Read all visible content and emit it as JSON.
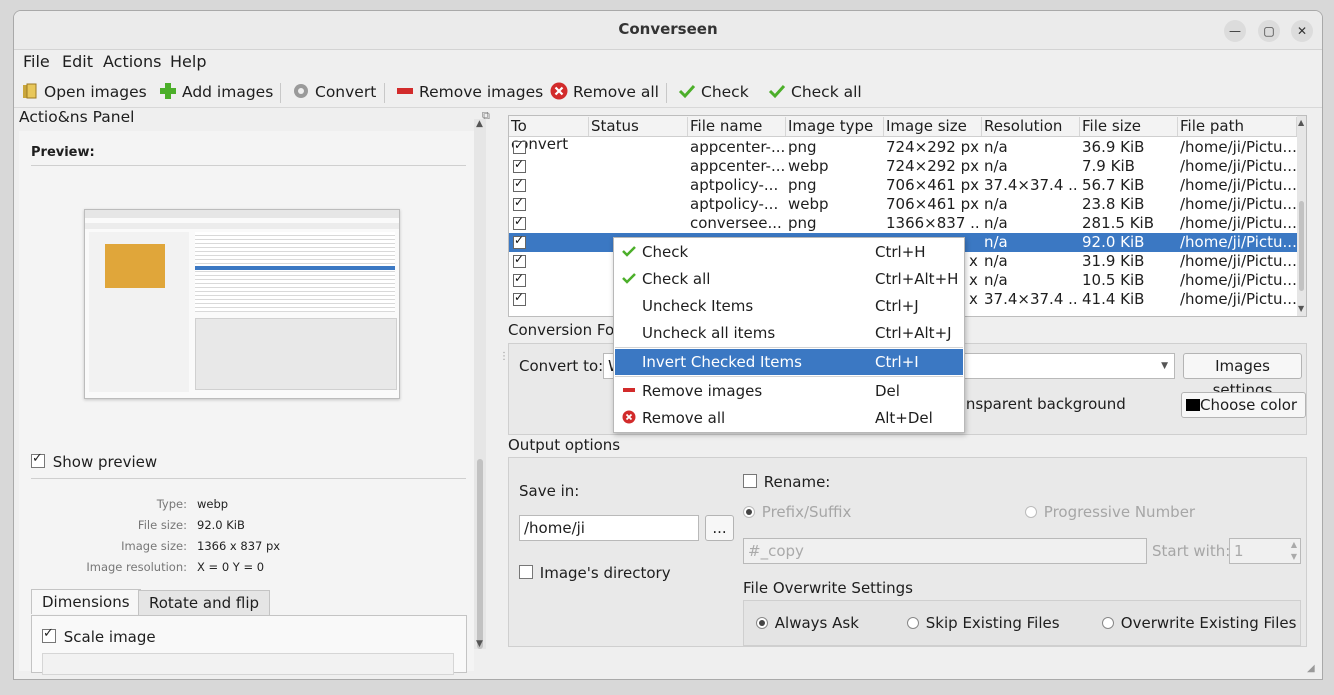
{
  "window": {
    "title": "Converseen"
  },
  "menu": [
    "File",
    "Edit",
    "Actions",
    "Help"
  ],
  "toolbar": {
    "open_images": "Open images",
    "add_images": "Add images",
    "convert": "Convert",
    "remove_images": "Remove images",
    "remove_all": "Remove all",
    "check": "Check",
    "check_all": "Check all"
  },
  "left": {
    "panel_title": "Actio&ns Panel",
    "preview_label": "Preview:",
    "show_preview": "Show preview",
    "info": [
      {
        "label": "Type:",
        "value": "webp"
      },
      {
        "label": "File size:",
        "value": "92.0 KiB"
      },
      {
        "label": "Image size:",
        "value": "1366 x 837 px"
      },
      {
        "label": "Image resolution:",
        "value": "X = 0 Y = 0"
      }
    ],
    "tabs": [
      "Dimensions",
      "Rotate and flip"
    ],
    "scale_image": "Scale image"
  },
  "table": {
    "headers": [
      "To convert",
      "Status",
      "File name",
      "Image type",
      "Image size",
      "Resolution",
      "File size",
      "File path"
    ],
    "rows": [
      {
        "name": "appcenter-...",
        "type": "png",
        "size": "724×292 px",
        "res": "n/a",
        "fsize": "36.9 KiB",
        "path": "/home/ji/Pictu..."
      },
      {
        "name": "appcenter-...",
        "type": "webp",
        "size": "724×292 px",
        "res": "n/a",
        "fsize": "7.9 KiB",
        "path": "/home/ji/Pictu..."
      },
      {
        "name": "aptpolicy-...",
        "type": "png",
        "size": "706×461 px",
        "res": "37.4×37.4 ...",
        "fsize": "56.7 KiB",
        "path": "/home/ji/Pictu..."
      },
      {
        "name": "aptpolicy-...",
        "type": "webp",
        "size": "706×461 px",
        "res": "n/a",
        "fsize": "23.8 KiB",
        "path": "/home/ji/Pictu..."
      },
      {
        "name": "conversee...",
        "type": "png",
        "size": "1366×837 ...",
        "res": "n/a",
        "fsize": "281.5 KiB",
        "path": "/home/ji/Pictu..."
      },
      {
        "name": "",
        "type": "",
        "size": "",
        "res": "n/a",
        "fsize": "92.0 KiB",
        "path": "/home/ji/Pictu..."
      },
      {
        "name": "",
        "type": "",
        "size": "x",
        "res": "n/a",
        "fsize": "31.9 KiB",
        "path": "/home/ji/Pictu..."
      },
      {
        "name": "",
        "type": "",
        "size": "x",
        "res": "n/a",
        "fsize": "10.5 KiB",
        "path": "/home/ji/Pictu..."
      },
      {
        "name": "",
        "type": "",
        "size": "x",
        "res": "37.4×37.4 ...",
        "fsize": "41.4 KiB",
        "path": "/home/ji/Pictu..."
      }
    ]
  },
  "conversion": {
    "title": "Conversion For",
    "convert_to_label": "Convert to:",
    "convert_to_value": "W",
    "images_settings": "Images settings",
    "replace_bg": "lace transparent background",
    "choose_color": "Choose color"
  },
  "output": {
    "title": "Output options",
    "save_in_label": "Save in:",
    "save_in_value": "/home/ji",
    "browse": "...",
    "image_dir": "Image's directory",
    "rename": "Rename:",
    "prefix_suffix": "Prefix/Suffix",
    "progressive": "Progressive Number",
    "name_placeholder": "#_copy",
    "start_with_label": "Start with:",
    "start_with_value": "1",
    "overwrite_title": "File Overwrite Settings",
    "always_ask": "Always Ask",
    "skip_existing": "Skip Existing Files",
    "overwrite_existing": "Overwrite Existing Files"
  },
  "context_menu": [
    {
      "label": "Check",
      "shortcut": "Ctrl+H",
      "icon": "green-check-icon"
    },
    {
      "label": "Check all",
      "shortcut": "Ctrl+Alt+H",
      "icon": "green-check-icon"
    },
    {
      "label": "Uncheck Items",
      "shortcut": "Ctrl+J",
      "icon": ""
    },
    {
      "label": "Uncheck all items",
      "shortcut": "Ctrl+Alt+J",
      "icon": ""
    },
    {
      "label": "Invert Checked Items",
      "shortcut": "Ctrl+I",
      "icon": ""
    },
    {
      "label": "Remove images",
      "shortcut": "Del",
      "icon": "red-minus-icon"
    },
    {
      "label": "Remove all",
      "shortcut": "Alt+Del",
      "icon": "red-x-icon"
    }
  ],
  "colors": {
    "selection": "#3b78c3",
    "accent_green": "#4caf2a",
    "danger_red": "#d22b2b"
  }
}
